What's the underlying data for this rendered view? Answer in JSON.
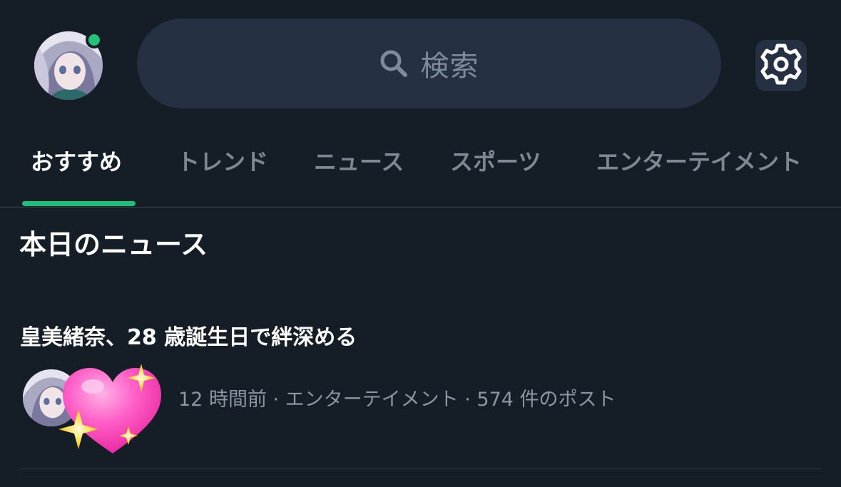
{
  "header": {
    "search": {
      "placeholder": "検索",
      "icon": "search-icon"
    },
    "settings_icon": "gear-icon",
    "online_status_color": "#21c27a"
  },
  "tabs": [
    {
      "label": "おすすめ",
      "active": true
    },
    {
      "label": "トレンド",
      "active": false
    },
    {
      "label": "ニュース",
      "active": false
    },
    {
      "label": "スポーツ",
      "active": false
    },
    {
      "label": "エンターテイメント",
      "active": false
    }
  ],
  "accent_color": "#1fbf7b",
  "section": {
    "title": "本日のニュース"
  },
  "news": [
    {
      "headline": "皇美緒奈、28 歳誕生日で絆深める",
      "meta": "12 時間前 · エンターテイメント · 574 件のポスト",
      "emoji": "sparkling-heart-icon"
    }
  ]
}
